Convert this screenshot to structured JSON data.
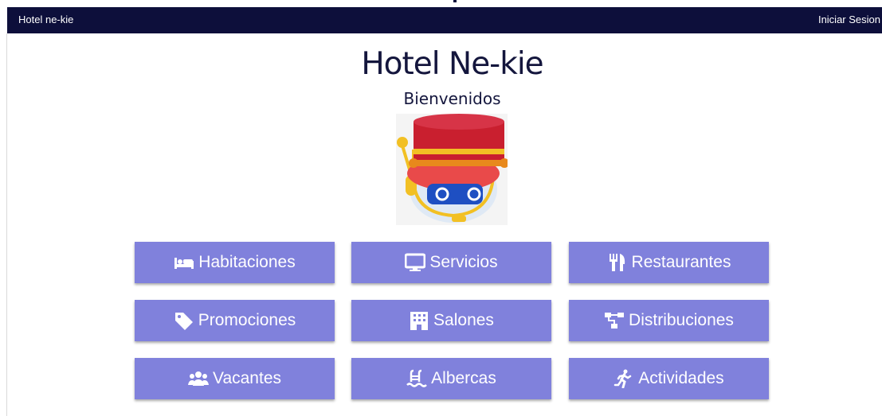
{
  "navbar": {
    "brand": "Hotel ne-kie",
    "login": "Iniciar Sesion"
  },
  "hero": {
    "title": "Hotel Ne-kie",
    "subtitle": "Bienvenidos"
  },
  "buttons": [
    {
      "label": "Habitaciones",
      "icon": "bed-icon"
    },
    {
      "label": "Servicios",
      "icon": "monitor-icon"
    },
    {
      "label": "Restaurantes",
      "icon": "utensils-icon"
    },
    {
      "label": "Promociones",
      "icon": "tag-icon"
    },
    {
      "label": "Salones",
      "icon": "building-icon"
    },
    {
      "label": "Distribuciones",
      "icon": "sitemap-icon"
    },
    {
      "label": "Vacantes",
      "icon": "users-icon"
    },
    {
      "label": "Albercas",
      "icon": "pool-icon"
    },
    {
      "label": "Actividades",
      "icon": "running-icon"
    }
  ],
  "colors": {
    "navbar": "#0d0f3b",
    "button": "#8081dc",
    "title": "#14163d"
  }
}
